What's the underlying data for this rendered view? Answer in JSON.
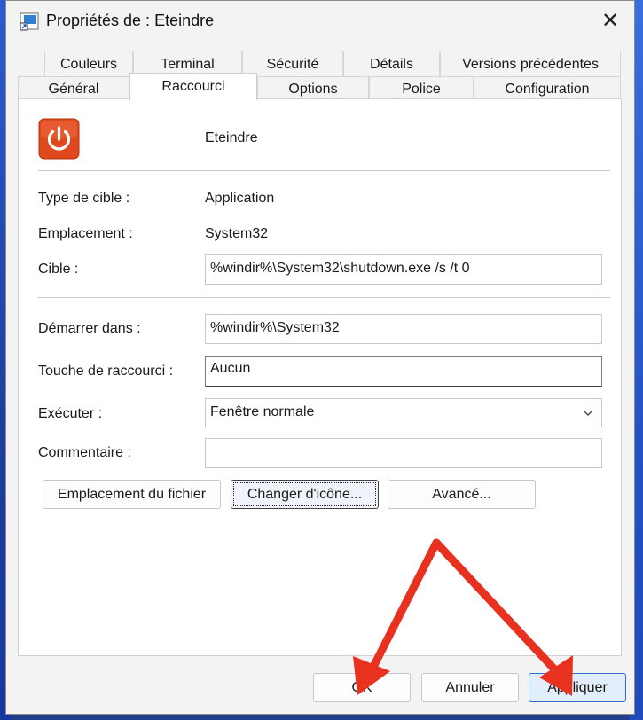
{
  "window": {
    "title": "Propriétés de : Eteindre",
    "close_glyph": "✕"
  },
  "tabs": {
    "row1": [
      "Couleurs",
      "Terminal",
      "Sécurité",
      "Détails",
      "Versions précédentes"
    ],
    "row2": [
      "Général",
      "Raccourci",
      "Options",
      "Police",
      "Configuration"
    ],
    "active": "Raccourci"
  },
  "shortcut": {
    "name": "Eteindre",
    "icon": "power-icon",
    "icon_color": "#e0481e",
    "target_type_label": "Type de cible :",
    "target_type_value": "Application",
    "location_label": "Emplacement :",
    "location_value": "System32",
    "target_label": "Cible :",
    "target_value": "%windir%\\System32\\shutdown.exe /s /t 0",
    "start_in_label": "Démarrer dans :",
    "start_in_value": "%windir%\\System32",
    "hotkey_label": "Touche de raccourci :",
    "hotkey_value": "Aucun",
    "run_label": "Exécuter :",
    "run_value": "Fenêtre normale",
    "comment_label": "Commentaire :",
    "comment_value": ""
  },
  "buttons": {
    "open_location": "Emplacement du fichier",
    "change_icon": "Changer d'icône...",
    "advanced": "Avancé...",
    "ok": "OK",
    "cancel": "Annuler",
    "apply": "Appliquer"
  },
  "annotation": {
    "arrow_color": "#e8311f"
  }
}
